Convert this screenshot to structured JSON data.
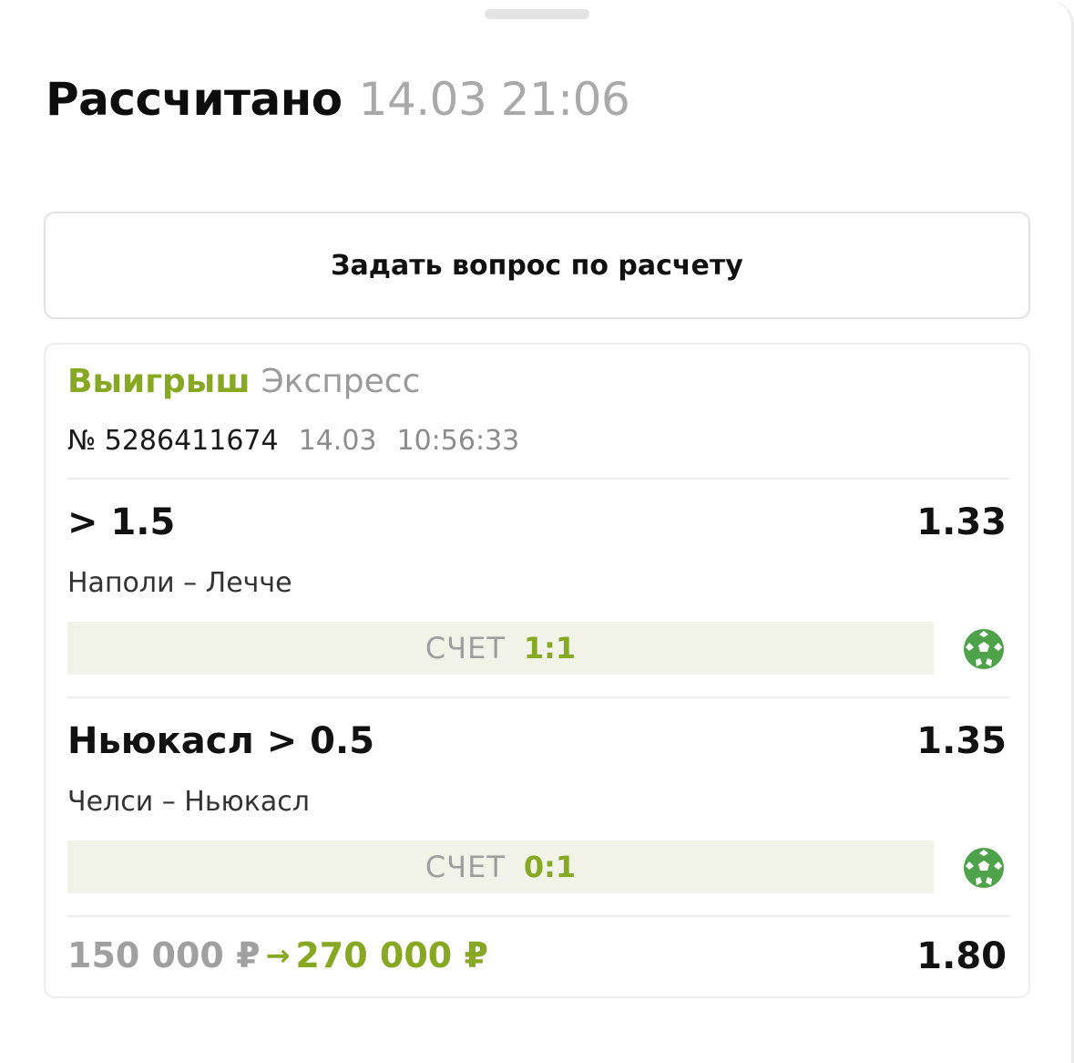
{
  "header": {
    "status": "Рассчитано",
    "datetime": "14.03 21:06"
  },
  "question_button": {
    "label": "Задать вопрос по расчету"
  },
  "bet": {
    "result": "Выигрыш",
    "type": "Экспресс",
    "number": "№ 5286411674",
    "date": "14.03",
    "time": "10:56:33",
    "selections": [
      {
        "outcome": "> 1.5",
        "odds": "1.33",
        "event": "Наполи – Лечче",
        "score_label": "СЧЕТ",
        "score": "1:1",
        "sport_icon": "soccer-ball-icon"
      },
      {
        "outcome": "Ньюкасл > 0.5",
        "odds": "1.35",
        "event": "Челси – Ньюкасл",
        "score_label": "СЧЕТ",
        "score": "0:1",
        "sport_icon": "soccer-ball-icon"
      }
    ],
    "stake": "150 000 ₽",
    "arrow": "→",
    "payout": "270 000 ₽",
    "total_odds": "1.80"
  },
  "colors": {
    "accent_green": "#86a822",
    "score_bg": "#f1f3e8",
    "muted_gray": "#a9a9a9",
    "icon_green": "#4ea34a"
  }
}
